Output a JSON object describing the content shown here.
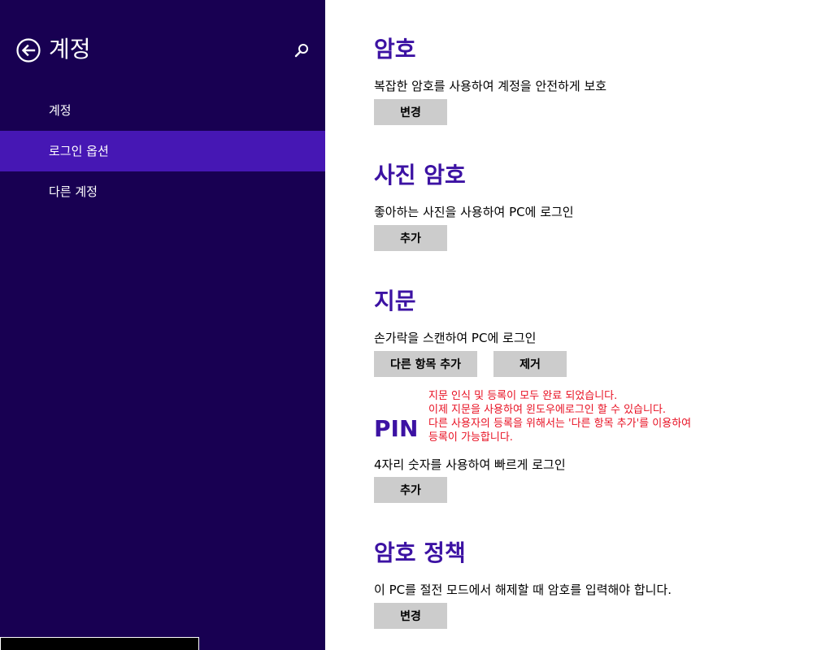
{
  "sidebar": {
    "title": "계정",
    "back_icon": "back-arrow-circle-icon",
    "search_icon": "search-icon",
    "items": [
      {
        "label": "계정",
        "selected": false
      },
      {
        "label": "로그인 옵션",
        "selected": true
      },
      {
        "label": "다른 계정",
        "selected": false
      }
    ]
  },
  "sections": {
    "password": {
      "title": "암호",
      "description": "복잡한 암호를 사용하여 계정을 안전하게 보호",
      "button": "변경"
    },
    "picture_password": {
      "title": "사진 암호",
      "description": "좋아하는 사진을 사용하여 PC에 로그인",
      "button": "추가"
    },
    "fingerprint": {
      "title": "지문",
      "description": "손가락을 스캔하여 PC에 로그인",
      "add_button": "다른 항목 추가",
      "remove_button": "제거"
    },
    "pin": {
      "title": "PIN",
      "description": "4자리 숫자를 사용하여 빠르게 로그인",
      "button": "추가"
    },
    "password_policy": {
      "title": "암호 정책",
      "description": "이 PC를 절전 모드에서 해제할 때 암호를 입력해야 합니다.",
      "button": "변경"
    }
  },
  "annotation": {
    "lines": [
      "지문 인식 및 등록이 모두 완료 되었습니다.",
      "이제 지문을 사용하여 윈도우에로그인 할 수 있습니다.",
      "다른 사용자의 등록을 위해서는 '다른 항목 추가'를 이용하여",
      "등록이 가능합니다."
    ],
    "color": "#e81123"
  },
  "colors": {
    "sidebar_bg": "#180052",
    "sidebar_selected": "#4617b4",
    "heading": "#3c12a3",
    "button_bg": "#cccccc"
  }
}
